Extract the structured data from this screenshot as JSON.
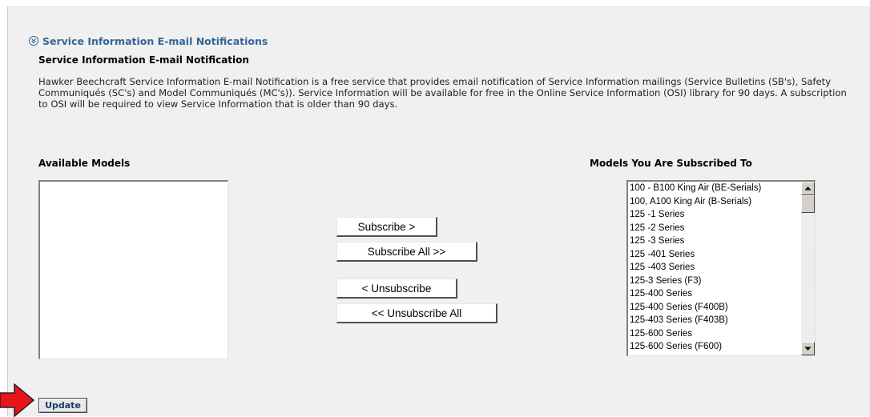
{
  "section": {
    "toggle_label": "Service Information E-mail Notifications",
    "heading": "Service Information E-mail Notification",
    "description": "Hawker Beechcraft Service Information E-mail Notification is a free service that provides email notification of Service Information mailings (Service Bulletins (SB's), Safety Communiqués (SC's) and Model Communiqués (MC's)). Service Information will be available for free in the Online Service Information (OSI) library for 90 days.  A subscription to OSI will be required to view Service Information that is older than 90 days."
  },
  "available_models": {
    "label": "Available Models",
    "items": []
  },
  "subscribed_models": {
    "label": "Models You Are Subscribed To",
    "items": [
      "100 - B100 King Air (BE-Serials)",
      "100, A100 King Air (B-Serials)",
      "125 -1 Series",
      "125 -2 Series",
      "125 -3 Series",
      "125 -401 Series",
      "125 -403 Series",
      "125-3 Series (F3)",
      "125-400 Series",
      "125-400 Series (F400B)",
      "125-403 Series (F403B)",
      "125-600 Series",
      "125-600 Series (F600)"
    ]
  },
  "buttons": {
    "subscribe": "Subscribe >",
    "subscribe_all": "Subscribe All >>",
    "unsubscribe": "< Unsubscribe",
    "unsubscribe_all": "<< Unsubscribe All",
    "update": "Update"
  },
  "colors": {
    "link": "#336699",
    "panel_bg": "#f0f0f0",
    "arrow": "#e8141c"
  },
  "icons": {
    "toggle": "double-chevron-down-icon",
    "pointer": "red-arrow-icon",
    "scroll_up": "scroll-up-arrow-icon",
    "scroll_down": "scroll-down-arrow-icon"
  }
}
